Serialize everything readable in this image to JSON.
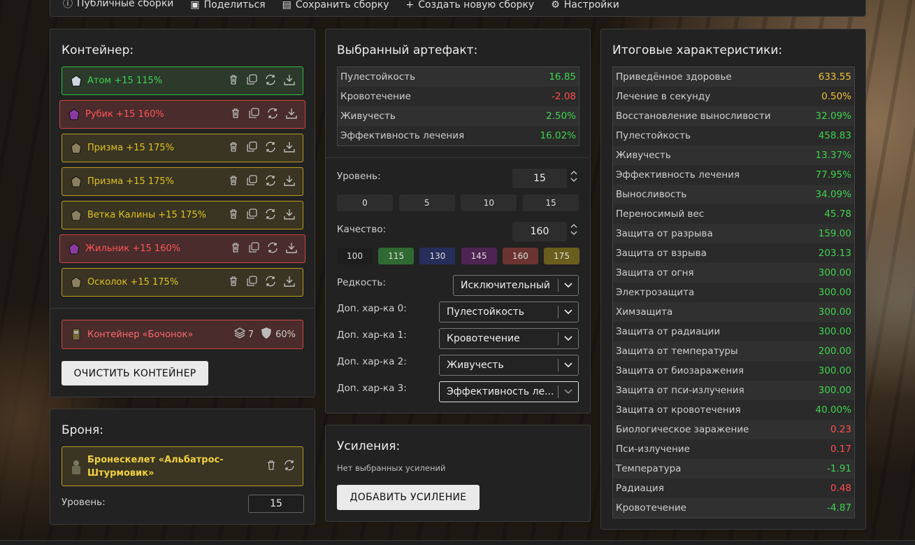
{
  "topbar": {
    "items": [
      {
        "icon": "info-icon",
        "label": "Публичные сборки"
      },
      {
        "icon": "share-icon",
        "label": "Поделиться"
      },
      {
        "icon": "save-icon",
        "label": "Сохранить сборку"
      },
      {
        "icon": "plus-icon",
        "label": "Создать новую сборку"
      },
      {
        "icon": "gear-icon",
        "label": "Настройки"
      }
    ]
  },
  "container": {
    "title": "Контейнер:",
    "artifacts": [
      {
        "name": "Атом +15 115%",
        "rarity": "green"
      },
      {
        "name": "Рубик +15 160%",
        "rarity": "red"
      },
      {
        "name": "Призма +15 175%",
        "rarity": "yellow"
      },
      {
        "name": "Призма +15 175%",
        "rarity": "yellow"
      },
      {
        "name": "Ветка Калины +15 175%",
        "rarity": "yellow"
      },
      {
        "name": "Жильник +15 160%",
        "rarity": "red"
      },
      {
        "name": "Осколок +15 175%",
        "rarity": "yellow"
      }
    ],
    "box": {
      "name": "Контейнер «Бочонок»",
      "slots": "7",
      "protection": "60%"
    },
    "clear_button": "ОЧИСТИТЬ КОНТЕЙНЕР"
  },
  "armor": {
    "title": "Броня:",
    "name": "Бронескелет «Альбатрос-Штурмовик»",
    "level_label": "Уровень:",
    "level": "15"
  },
  "selected": {
    "title": "Выбранный артефакт:",
    "stats": [
      {
        "name": "Пулестойкость",
        "value": "16.85"
      },
      {
        "name": "Кровотечение",
        "value": "-2.08"
      },
      {
        "name": "Живучесть",
        "value": "2.50%"
      },
      {
        "name": "Эффективность лечения",
        "value": "16.02%"
      }
    ],
    "level_label": "Уровень:",
    "level": "15",
    "level_presets": [
      "0",
      "5",
      "10",
      "15"
    ],
    "quality_label": "Качество:",
    "quality": "160",
    "quality_presets": [
      {
        "v": "100",
        "color": "#1e1e1e"
      },
      {
        "v": "115",
        "color": "#2f6a32"
      },
      {
        "v": "130",
        "color": "#262e5c"
      },
      {
        "v": "145",
        "color": "#4d2452"
      },
      {
        "v": "160",
        "color": "#6b3431"
      },
      {
        "v": "175",
        "color": "#6a5d1e"
      }
    ],
    "rarity_label": "Редкость:",
    "rarity": "Исключительный",
    "extras": [
      {
        "label": "Доп. хар-ка 0:",
        "value": "Пулестойкость"
      },
      {
        "label": "Доп. хар-ка 1:",
        "value": "Кровотечение"
      },
      {
        "label": "Доп. хар-ка 2:",
        "value": "Живучесть"
      },
      {
        "label": "Доп. хар-ка 3:",
        "value": "Эффективность ле..."
      }
    ]
  },
  "boosts": {
    "title": "Усиления:",
    "empty": "Нет выбранных усилений",
    "add_button": "ДОБАВИТЬ УСИЛЕНИЕ"
  },
  "totals": {
    "title": "Итоговые характеристики:",
    "stats": [
      {
        "name": "Приведённое здоровье",
        "value": "633.55",
        "tone": "gold"
      },
      {
        "name": "Лечение в секунду",
        "value": "0.50%",
        "tone": "gold"
      },
      {
        "name": "Восстановление выносливости",
        "value": "32.09%",
        "tone": "pos"
      },
      {
        "name": "Пулестойкость",
        "value": "458.83",
        "tone": "pos"
      },
      {
        "name": "Живучесть",
        "value": "13.37%",
        "tone": "pos"
      },
      {
        "name": "Эффективность лечения",
        "value": "77.95%",
        "tone": "pos"
      },
      {
        "name": "Выносливость",
        "value": "34.09%",
        "tone": "pos"
      },
      {
        "name": "Переносимый вес",
        "value": "45.78",
        "tone": "pos"
      },
      {
        "name": "Защита от разрыва",
        "value": "159.00",
        "tone": "pos"
      },
      {
        "name": "Защита от взрыва",
        "value": "203.13",
        "tone": "pos"
      },
      {
        "name": "Защита от огня",
        "value": "300.00",
        "tone": "pos"
      },
      {
        "name": "Электрозащита",
        "value": "300.00",
        "tone": "pos"
      },
      {
        "name": "Химзащита",
        "value": "300.00",
        "tone": "pos"
      },
      {
        "name": "Защита от радиации",
        "value": "300.00",
        "tone": "pos"
      },
      {
        "name": "Защита от температуры",
        "value": "200.00",
        "tone": "pos"
      },
      {
        "name": "Защита от биозаражения",
        "value": "300.00",
        "tone": "pos"
      },
      {
        "name": "Защита от пси-излучения",
        "value": "300.00",
        "tone": "pos"
      },
      {
        "name": "Защита от кровотечения",
        "value": "40.00%",
        "tone": "pos"
      },
      {
        "name": "Биологическое заражение",
        "value": "0.23",
        "tone": "neg"
      },
      {
        "name": "Пси-излучение",
        "value": "0.17",
        "tone": "neg"
      },
      {
        "name": "Температура",
        "value": "-1.91",
        "tone": "pos"
      },
      {
        "name": "Радиация",
        "value": "0.48",
        "tone": "neg"
      },
      {
        "name": "Кровотечение",
        "value": "-4.87",
        "tone": "pos"
      }
    ]
  }
}
